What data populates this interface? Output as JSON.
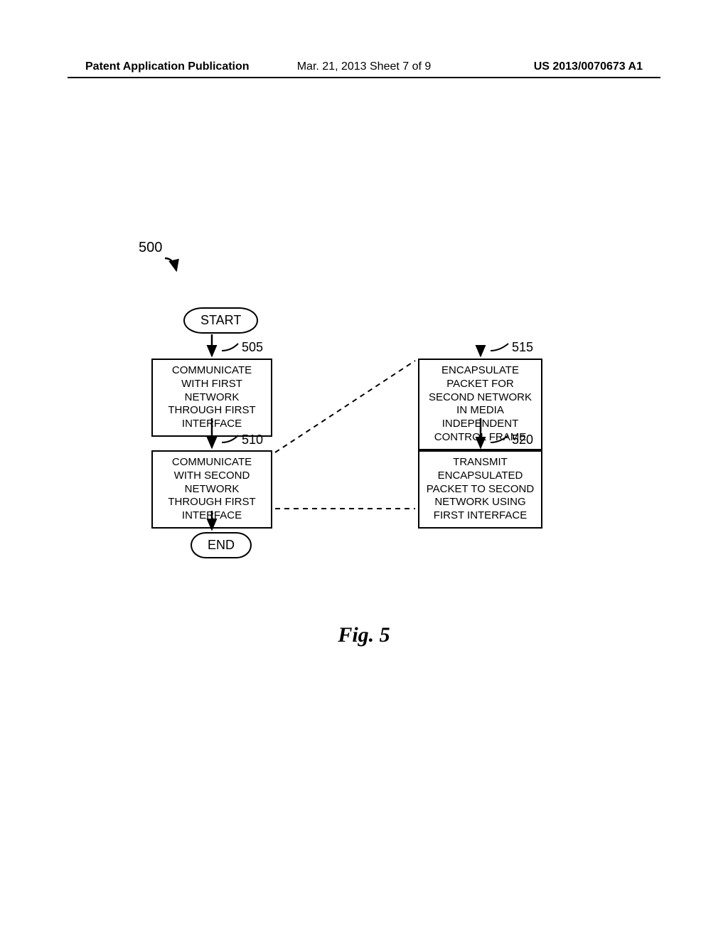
{
  "header": {
    "left": "Patent Application Publication",
    "center": "Mar. 21, 2013  Sheet 7 of 9",
    "right": "US 2013/0070673 A1"
  },
  "diagram": {
    "ref500": "500",
    "ref505": "505",
    "ref510": "510",
    "ref515": "515",
    "ref520": "520",
    "start": "START",
    "end": "END",
    "box505": "COMMUNICATE WITH FIRST NETWORK THROUGH FIRST INTERFACE",
    "box510": "COMMUNICATE WITH SECOND NETWORK THROUGH FIRST INTERFACE",
    "box515": "ENCAPSULATE PACKET FOR SECOND NETWORK IN MEDIA INDEPENDENT CONTROL FRAME",
    "box520": "TRANSMIT ENCAPSULATED PACKET TO SECOND NETWORK USING FIRST INTERFACE"
  },
  "figureLabel": "Fig. 5"
}
